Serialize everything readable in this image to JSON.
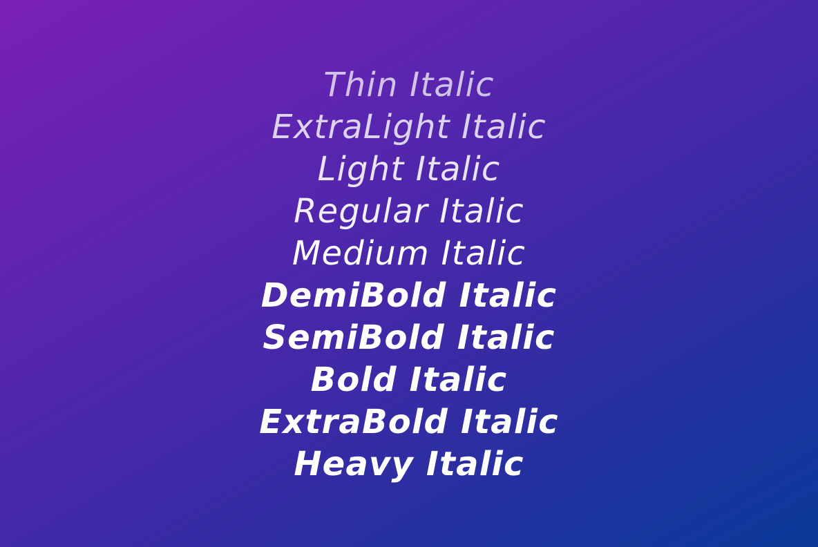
{
  "weights": [
    {
      "label": "Thin Italic"
    },
    {
      "label": "ExtraLight Italic"
    },
    {
      "label": "Light Italic"
    },
    {
      "label": "Regular Italic"
    },
    {
      "label": "Medium Italic"
    },
    {
      "label": "DemiBold Italic"
    },
    {
      "label": "SemiBold Italic"
    },
    {
      "label": "Bold Italic"
    },
    {
      "label": "ExtraBold Italic"
    },
    {
      "label": "Heavy Italic"
    }
  ],
  "colors": {
    "text": "#ffffff",
    "gradient_start": "#7a1fb8",
    "gradient_end": "#0b3a9a"
  }
}
